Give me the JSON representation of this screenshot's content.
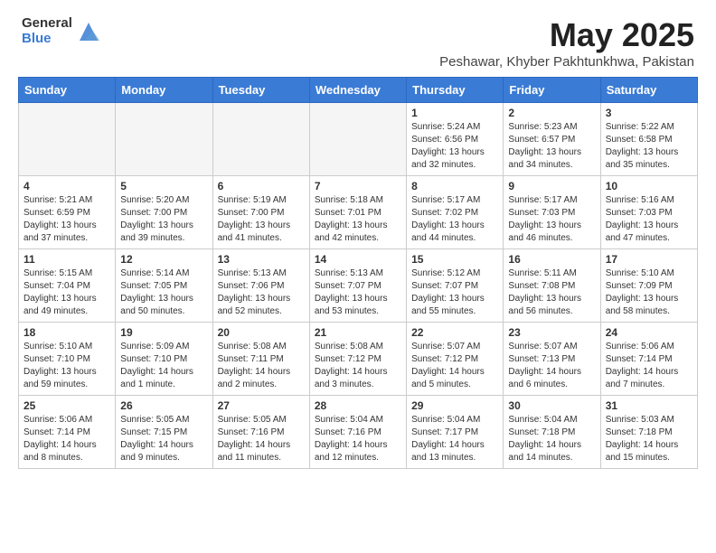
{
  "logo": {
    "general": "General",
    "blue": "Blue"
  },
  "header": {
    "month": "May 2025",
    "location": "Peshawar, Khyber Pakhtunkhwa, Pakistan"
  },
  "weekdays": [
    "Sunday",
    "Monday",
    "Tuesday",
    "Wednesday",
    "Thursday",
    "Friday",
    "Saturday"
  ],
  "weeks": [
    [
      {
        "day": "",
        "info": ""
      },
      {
        "day": "",
        "info": ""
      },
      {
        "day": "",
        "info": ""
      },
      {
        "day": "",
        "info": ""
      },
      {
        "day": "1",
        "info": "Sunrise: 5:24 AM\nSunset: 6:56 PM\nDaylight: 13 hours\nand 32 minutes."
      },
      {
        "day": "2",
        "info": "Sunrise: 5:23 AM\nSunset: 6:57 PM\nDaylight: 13 hours\nand 34 minutes."
      },
      {
        "day": "3",
        "info": "Sunrise: 5:22 AM\nSunset: 6:58 PM\nDaylight: 13 hours\nand 35 minutes."
      }
    ],
    [
      {
        "day": "4",
        "info": "Sunrise: 5:21 AM\nSunset: 6:59 PM\nDaylight: 13 hours\nand 37 minutes."
      },
      {
        "day": "5",
        "info": "Sunrise: 5:20 AM\nSunset: 7:00 PM\nDaylight: 13 hours\nand 39 minutes."
      },
      {
        "day": "6",
        "info": "Sunrise: 5:19 AM\nSunset: 7:00 PM\nDaylight: 13 hours\nand 41 minutes."
      },
      {
        "day": "7",
        "info": "Sunrise: 5:18 AM\nSunset: 7:01 PM\nDaylight: 13 hours\nand 42 minutes."
      },
      {
        "day": "8",
        "info": "Sunrise: 5:17 AM\nSunset: 7:02 PM\nDaylight: 13 hours\nand 44 minutes."
      },
      {
        "day": "9",
        "info": "Sunrise: 5:17 AM\nSunset: 7:03 PM\nDaylight: 13 hours\nand 46 minutes."
      },
      {
        "day": "10",
        "info": "Sunrise: 5:16 AM\nSunset: 7:03 PM\nDaylight: 13 hours\nand 47 minutes."
      }
    ],
    [
      {
        "day": "11",
        "info": "Sunrise: 5:15 AM\nSunset: 7:04 PM\nDaylight: 13 hours\nand 49 minutes."
      },
      {
        "day": "12",
        "info": "Sunrise: 5:14 AM\nSunset: 7:05 PM\nDaylight: 13 hours\nand 50 minutes."
      },
      {
        "day": "13",
        "info": "Sunrise: 5:13 AM\nSunset: 7:06 PM\nDaylight: 13 hours\nand 52 minutes."
      },
      {
        "day": "14",
        "info": "Sunrise: 5:13 AM\nSunset: 7:07 PM\nDaylight: 13 hours\nand 53 minutes."
      },
      {
        "day": "15",
        "info": "Sunrise: 5:12 AM\nSunset: 7:07 PM\nDaylight: 13 hours\nand 55 minutes."
      },
      {
        "day": "16",
        "info": "Sunrise: 5:11 AM\nSunset: 7:08 PM\nDaylight: 13 hours\nand 56 minutes."
      },
      {
        "day": "17",
        "info": "Sunrise: 5:10 AM\nSunset: 7:09 PM\nDaylight: 13 hours\nand 58 minutes."
      }
    ],
    [
      {
        "day": "18",
        "info": "Sunrise: 5:10 AM\nSunset: 7:10 PM\nDaylight: 13 hours\nand 59 minutes."
      },
      {
        "day": "19",
        "info": "Sunrise: 5:09 AM\nSunset: 7:10 PM\nDaylight: 14 hours\nand 1 minute."
      },
      {
        "day": "20",
        "info": "Sunrise: 5:08 AM\nSunset: 7:11 PM\nDaylight: 14 hours\nand 2 minutes."
      },
      {
        "day": "21",
        "info": "Sunrise: 5:08 AM\nSunset: 7:12 PM\nDaylight: 14 hours\nand 3 minutes."
      },
      {
        "day": "22",
        "info": "Sunrise: 5:07 AM\nSunset: 7:12 PM\nDaylight: 14 hours\nand 5 minutes."
      },
      {
        "day": "23",
        "info": "Sunrise: 5:07 AM\nSunset: 7:13 PM\nDaylight: 14 hours\nand 6 minutes."
      },
      {
        "day": "24",
        "info": "Sunrise: 5:06 AM\nSunset: 7:14 PM\nDaylight: 14 hours\nand 7 minutes."
      }
    ],
    [
      {
        "day": "25",
        "info": "Sunrise: 5:06 AM\nSunset: 7:14 PM\nDaylight: 14 hours\nand 8 minutes."
      },
      {
        "day": "26",
        "info": "Sunrise: 5:05 AM\nSunset: 7:15 PM\nDaylight: 14 hours\nand 9 minutes."
      },
      {
        "day": "27",
        "info": "Sunrise: 5:05 AM\nSunset: 7:16 PM\nDaylight: 14 hours\nand 11 minutes."
      },
      {
        "day": "28",
        "info": "Sunrise: 5:04 AM\nSunset: 7:16 PM\nDaylight: 14 hours\nand 12 minutes."
      },
      {
        "day": "29",
        "info": "Sunrise: 5:04 AM\nSunset: 7:17 PM\nDaylight: 14 hours\nand 13 minutes."
      },
      {
        "day": "30",
        "info": "Sunrise: 5:04 AM\nSunset: 7:18 PM\nDaylight: 14 hours\nand 14 minutes."
      },
      {
        "day": "31",
        "info": "Sunrise: 5:03 AM\nSunset: 7:18 PM\nDaylight: 14 hours\nand 15 minutes."
      }
    ]
  ]
}
